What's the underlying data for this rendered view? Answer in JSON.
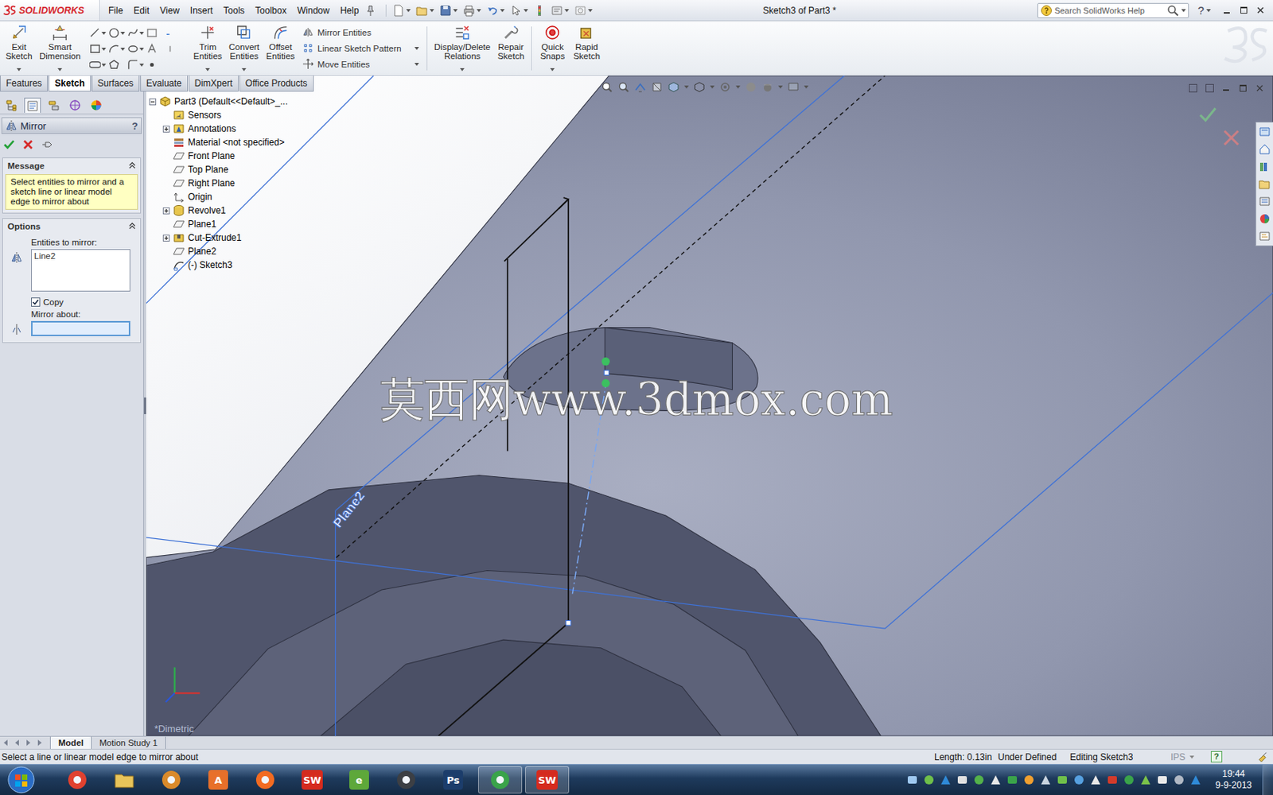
{
  "app": {
    "brand": "SOLIDWORKS"
  },
  "menu": [
    "File",
    "Edit",
    "View",
    "Insert",
    "Tools",
    "Toolbox",
    "Window",
    "Help"
  ],
  "window": {
    "title": "Sketch3 of Part3 *",
    "help": "?"
  },
  "search": {
    "placeholder": "Search SolidWorks Help"
  },
  "toolbar": {
    "large_left": [
      {
        "label": "Exit Sketch",
        "dropdown": true
      },
      {
        "label": "Smart Dimension",
        "dropdown": true
      }
    ],
    "large_mid": [
      {
        "label": "Trim Entities",
        "dropdown": true
      },
      {
        "label": "Convert Entities",
        "dropdown": true
      },
      {
        "label": "Offset Entities",
        "dropdown": false
      }
    ],
    "small": [
      {
        "label": "Mirror Entities",
        "dropdown": false
      },
      {
        "label": "Linear Sketch Pattern",
        "dropdown": true
      },
      {
        "label": "Move Entities",
        "dropdown": true
      }
    ],
    "large_right": [
      {
        "label": "Display/Delete Relations",
        "dropdown": true
      },
      {
        "label": "Repair Sketch",
        "dropdown": false
      },
      {
        "label": "Quick Snaps",
        "dropdown": true
      },
      {
        "label": "Rapid Sketch",
        "dropdown": false
      }
    ]
  },
  "command_tabs": [
    {
      "label": "Features",
      "selected": false
    },
    {
      "label": "Sketch",
      "selected": true
    },
    {
      "label": "Surfaces",
      "selected": false
    },
    {
      "label": "Evaluate",
      "selected": false
    },
    {
      "label": "DimXpert",
      "selected": false
    },
    {
      "label": "Office Products",
      "selected": false
    }
  ],
  "panel_tabs": [
    {
      "selected": false
    },
    {
      "selected": true
    },
    {
      "selected": false
    },
    {
      "selected": false
    },
    {
      "selected": false
    }
  ],
  "property_manager": {
    "title": "Mirror",
    "help": "?",
    "message": {
      "title": "Message",
      "text": "Select entities to mirror and a sketch line or linear model edge to mirror about"
    },
    "options": {
      "title": "Options",
      "entities_label": "Entities to mirror:",
      "entities": [
        "Line2"
      ],
      "copy": {
        "label": "Copy",
        "checked": true
      },
      "mirror_about_label": "Mirror about:",
      "mirror_about_focused": true
    }
  },
  "feature_tree": [
    {
      "label": "Part3  (Default<<Default>_...",
      "kind": "part",
      "depth": 0,
      "children": true,
      "expanded": true
    },
    {
      "label": "Sensors",
      "kind": "sensors",
      "depth": 1,
      "children": false,
      "expanded": false
    },
    {
      "label": "Annotations",
      "kind": "annotations",
      "depth": 1,
      "children": true,
      "expanded": false
    },
    {
      "label": "Material <not specified>",
      "kind": "material",
      "depth": 1,
      "children": false,
      "expanded": false
    },
    {
      "label": "Front Plane",
      "kind": "plane",
      "depth": 1,
      "children": false,
      "expanded": false
    },
    {
      "label": "Top Plane",
      "kind": "plane",
      "depth": 1,
      "children": false,
      "expanded": false
    },
    {
      "label": "Right Plane",
      "kind": "plane",
      "depth": 1,
      "children": false,
      "expanded": false
    },
    {
      "label": "Origin",
      "kind": "origin",
      "depth": 1,
      "children": false,
      "expanded": false
    },
    {
      "label": "Revolve1",
      "kind": "revolve",
      "depth": 1,
      "children": true,
      "expanded": false
    },
    {
      "label": "Plane1",
      "kind": "plane",
      "depth": 1,
      "children": false,
      "expanded": false
    },
    {
      "label": "Cut-Extrude1",
      "kind": "cut",
      "depth": 1,
      "children": true,
      "expanded": false
    },
    {
      "label": "Plane2",
      "kind": "plane",
      "depth": 1,
      "children": false,
      "expanded": false
    },
    {
      "label": "(-) Sketch3",
      "kind": "sketch",
      "depth": 1,
      "children": false,
      "expanded": false
    }
  ],
  "viewport": {
    "watermark": "莫西网www.3dmox.com",
    "plane_label": "Plane2",
    "view_label": "*Dimetric"
  },
  "bottom_tabs": [
    {
      "label": "Model",
      "selected": true
    },
    {
      "label": "Motion Study 1",
      "selected": false
    }
  ],
  "status_bar": {
    "message": "Select a line or linear model edge to mirror about",
    "length": "Length: 0.13in",
    "state": "Under Defined",
    "mode": "Editing Sketch3",
    "units": "IPS",
    "help": "?"
  },
  "taskbar": {
    "apps": [
      {
        "kind": "round",
        "glyph": "",
        "color": "#e0412f",
        "active": false
      },
      {
        "kind": "folder",
        "glyph": "",
        "color": "#e8c45a",
        "active": false
      },
      {
        "kind": "round",
        "glyph": "",
        "color": "#d98a2b",
        "active": false
      },
      {
        "kind": "letter",
        "glyph": "A",
        "color": "#e8702a",
        "active": false
      },
      {
        "kind": "round",
        "glyph": "",
        "color": "#f26b21",
        "active": false
      },
      {
        "kind": "letter",
        "glyph": "SW",
        "color": "#d52b1e",
        "active": false
      },
      {
        "kind": "letter",
        "glyph": "e",
        "color": "#5ea83a",
        "active": false
      },
      {
        "kind": "round",
        "glyph": "",
        "color": "#3c3f44",
        "active": false
      },
      {
        "kind": "letter",
        "glyph": "Ps",
        "color": "#1c3d6b",
        "active": false
      },
      {
        "kind": "round",
        "glyph": "",
        "color": "#3aa34a",
        "active": true
      },
      {
        "kind": "letter",
        "glyph": "SW",
        "color": "#d52b1e",
        "active": true
      }
    ],
    "time": "19:44",
    "date": "9-9-2013"
  }
}
